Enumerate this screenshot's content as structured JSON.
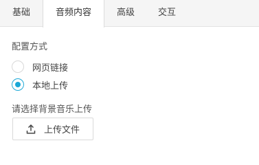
{
  "tabs": [
    {
      "label": "基础",
      "active": false
    },
    {
      "label": "音频内容",
      "active": true
    },
    {
      "label": "高级",
      "active": false
    },
    {
      "label": "交互",
      "active": false
    }
  ],
  "config": {
    "label": "配置方式",
    "options": [
      {
        "label": "网页链接",
        "selected": false
      },
      {
        "label": "本地上传",
        "selected": true
      }
    ]
  },
  "upload": {
    "label": "请选择背景音乐上传",
    "button_label": "上传文件",
    "icon": "upload-icon"
  },
  "colors": {
    "accent": "#1aa7d6",
    "tab_bar_bg": "#f5f5f5",
    "border": "#d9d9d9"
  }
}
